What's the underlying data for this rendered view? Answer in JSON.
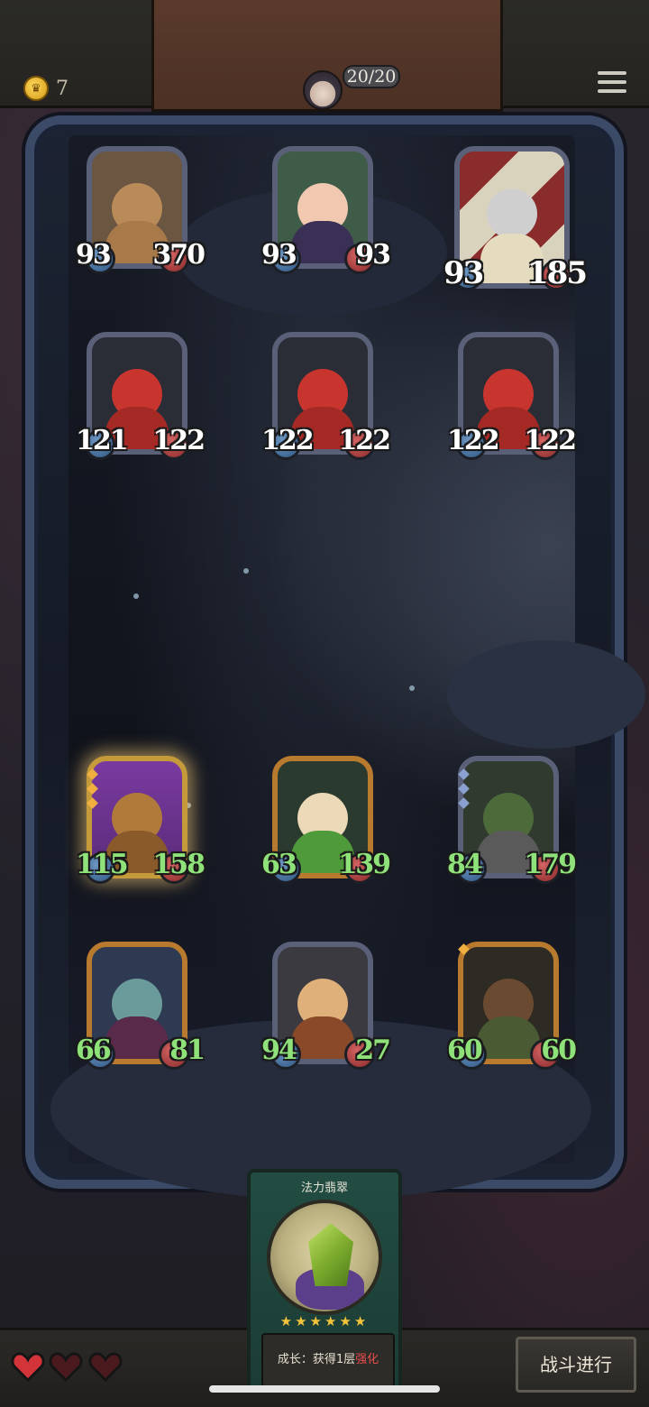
{
  "hud": {
    "coins": "7",
    "population": "20/20"
  },
  "enemy_row_1": [
    {
      "atk": "93",
      "hp": "370",
      "portrait": "ogre-brute"
    },
    {
      "atk": "93",
      "hp": "93",
      "portrait": "witch"
    },
    {
      "atk": "93",
      "hp": "185",
      "portrait": "spade-knight"
    }
  ],
  "enemy_row_2": [
    {
      "atk": "121",
      "hp": "122",
      "portrait": "red-imp"
    },
    {
      "atk": "122",
      "hp": "122",
      "portrait": "red-imp"
    },
    {
      "atk": "122",
      "hp": "122",
      "portrait": "red-imp"
    }
  ],
  "ally_row_1": [
    {
      "atk": "115",
      "hp": "158",
      "portrait": "bear"
    },
    {
      "atk": "63",
      "hp": "139",
      "portrait": "leaf-sprout"
    },
    {
      "atk": "84",
      "hp": "179",
      "portrait": "treant"
    }
  ],
  "ally_row_2": [
    {
      "atk": "66",
      "hp": "81",
      "portrait": "dark-elf"
    },
    {
      "atk": "94",
      "hp": "27",
      "portrait": "pirate"
    },
    {
      "atk": "60",
      "hp": "60",
      "portrait": "mushroom-goblin"
    }
  ],
  "shop_card": {
    "title": "法力翡翠",
    "stars": "★★★★★★",
    "desc_prefix": "成长：获得1层",
    "desc_keyword": "强化"
  },
  "lives": [
    "heart-full",
    "heart-empty",
    "heart-empty"
  ],
  "fight_button": "战斗进行",
  "colors": {
    "ally_stat": "#8fe27a",
    "enemy_stat": "#ffffff",
    "keyword": "#e84d4d",
    "star": "#f5c33a"
  }
}
